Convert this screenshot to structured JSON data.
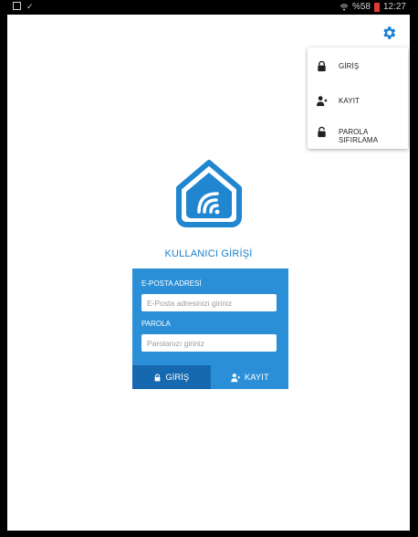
{
  "statusbar": {
    "battery_text": "%58",
    "time": "12:27"
  },
  "menu": {
    "items": [
      {
        "label": "GİRİŞ",
        "icon": "lock-icon"
      },
      {
        "label": "KAYIT",
        "icon": "person-add-icon"
      },
      {
        "label": "PAROLA SIFIRLAMA",
        "icon": "unlock-icon"
      }
    ]
  },
  "login": {
    "title": "KULLANICI GİRİŞİ",
    "email_label": "E-POSTA ADRESİ",
    "email_placeholder": "E-Posta adresinizi giriniz",
    "password_label": "PAROLA",
    "password_placeholder": "Parolanızı giriniz",
    "login_button": "GİRİŞ",
    "register_button": "KAYIT"
  },
  "colors": {
    "accent": "#2a8fd6",
    "accent_dark": "#1669ae",
    "title_blue": "#1b7ec7"
  }
}
